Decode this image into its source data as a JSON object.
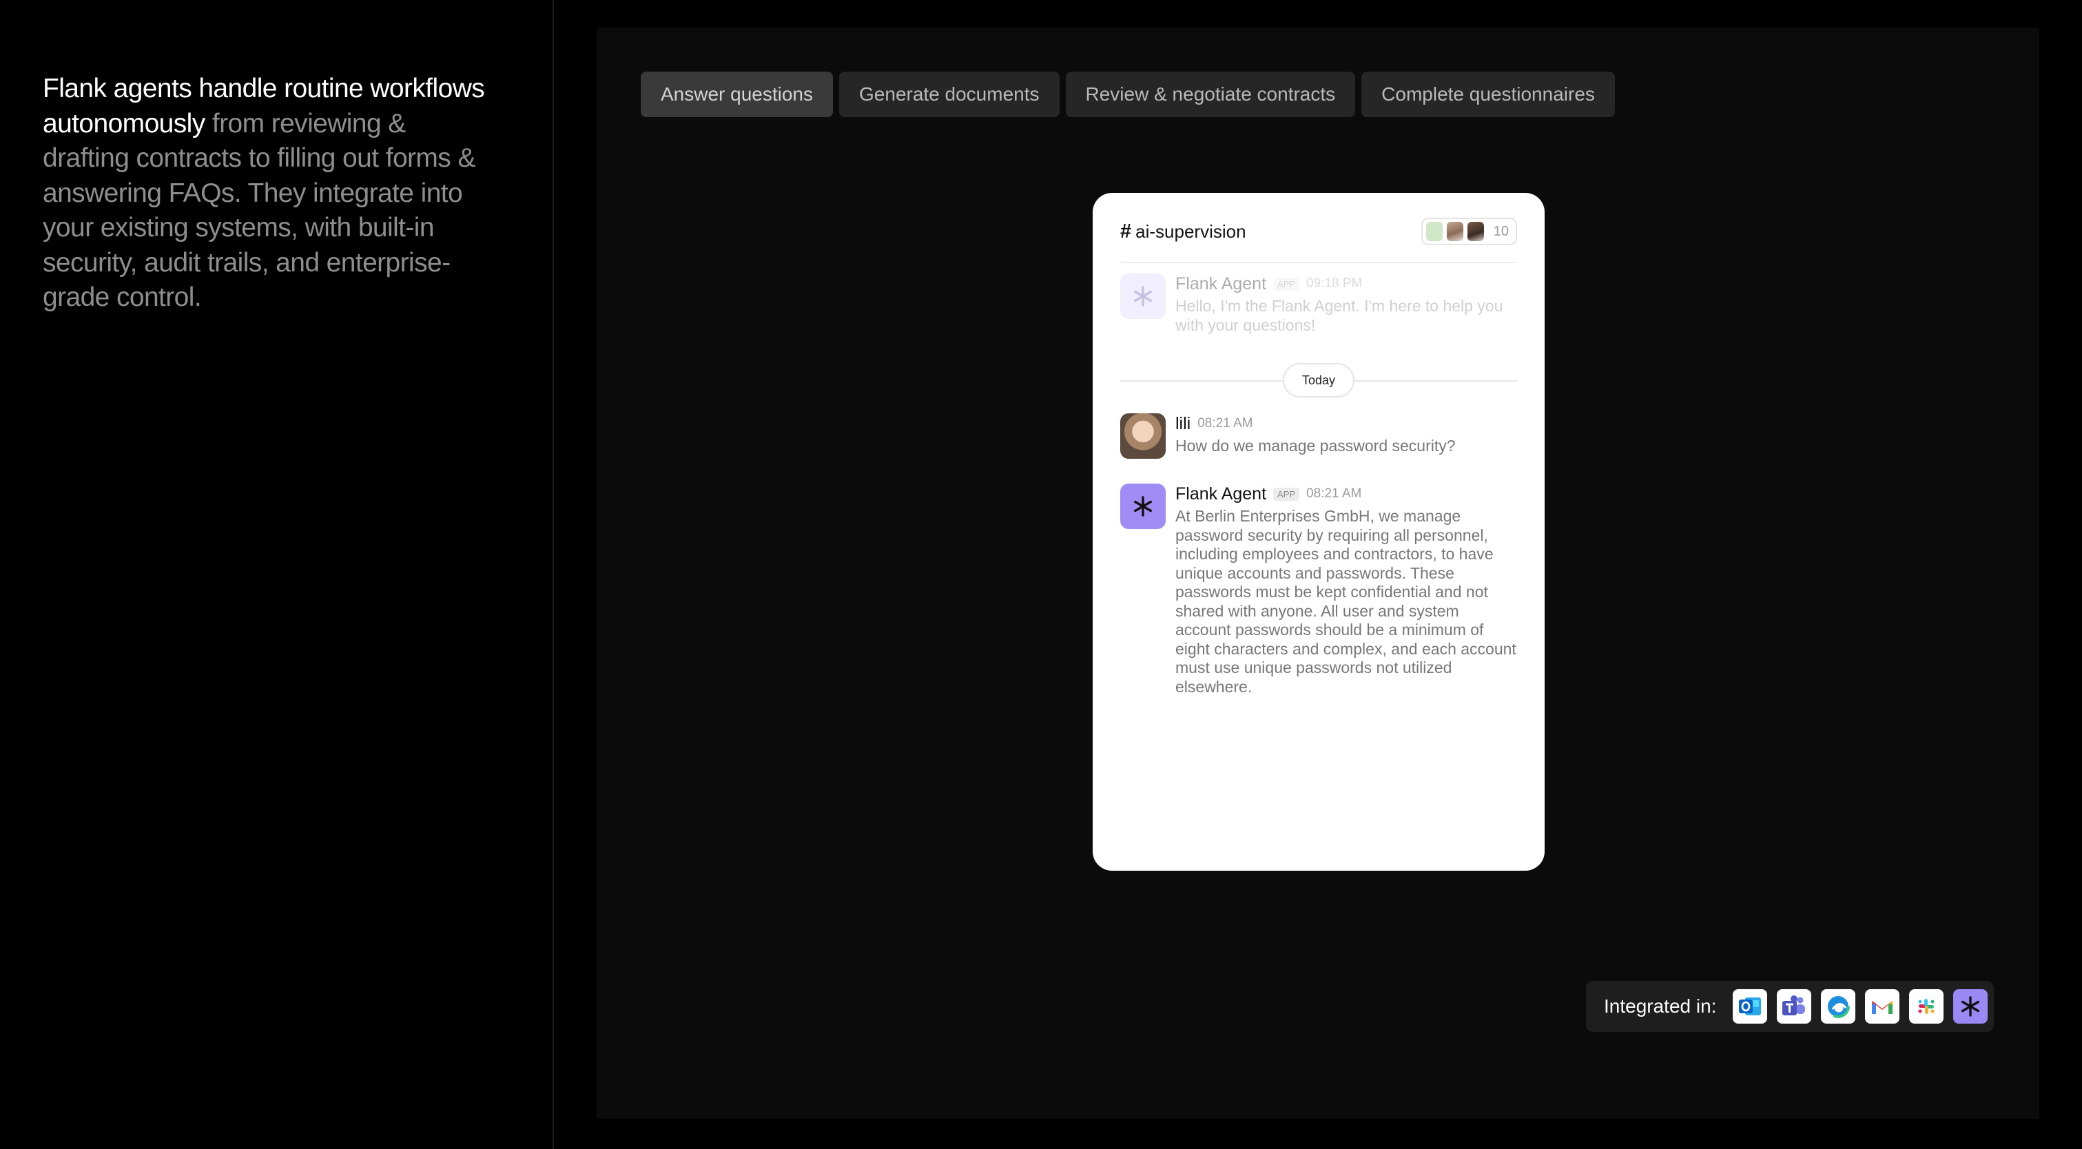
{
  "intro": {
    "highlight": "Flank agents handle routine workflows autonomously",
    "rest": " from reviewing & drafting contracts to filling out forms & answering FAQs. They integrate into your existing systems, with built-in security, audit trails, and enterprise-grade control."
  },
  "tabs": [
    {
      "label": "Answer questions",
      "active": true
    },
    {
      "label": "Generate documents",
      "active": false
    },
    {
      "label": "Review & negotiate contracts",
      "active": false
    },
    {
      "label": "Complete questionnaires",
      "active": false
    }
  ],
  "chat": {
    "channel_hash": "#",
    "channel_name": "ai-supervision",
    "member_count": "10",
    "divider_label": "Today",
    "messages": [
      {
        "name": "Flank Agent",
        "badge": "APP",
        "time": "09:18 PM",
        "text": "Hello, I'm the Flank Agent. I'm here to help you with your questions!",
        "avatar_icon": "asterisk-icon",
        "faded": true
      },
      {
        "name": "lili",
        "badge": "",
        "time": "08:21 AM",
        "text": "How do we manage password security?",
        "avatar_icon": "user-avatar",
        "faded": false
      },
      {
        "name": "Flank Agent",
        "badge": "APP",
        "time": "08:21 AM",
        "text": "At Berlin Enterprises GmbH, we manage password security by requiring all personnel, including employees and contractors, to have unique accounts and passwords. These passwords must be kept confidential and not shared with anyone. All user and system account passwords should be a minimum of eight characters and complex, and each account must use unique passwords not utilized elsewhere.",
        "avatar_icon": "asterisk-icon",
        "faded": false
      }
    ]
  },
  "integrations": {
    "label": "Integrated in:",
    "icons": [
      "outlook-icon",
      "teams-icon",
      "edge-icon",
      "gmail-icon",
      "slack-icon",
      "flank-icon"
    ]
  },
  "colors": {
    "background": "#000000",
    "stage": "#0b0b0b",
    "tab": "#262626",
    "tab_active": "#3a3a3a",
    "accent": "#9a88f4",
    "card": "#ffffff"
  }
}
